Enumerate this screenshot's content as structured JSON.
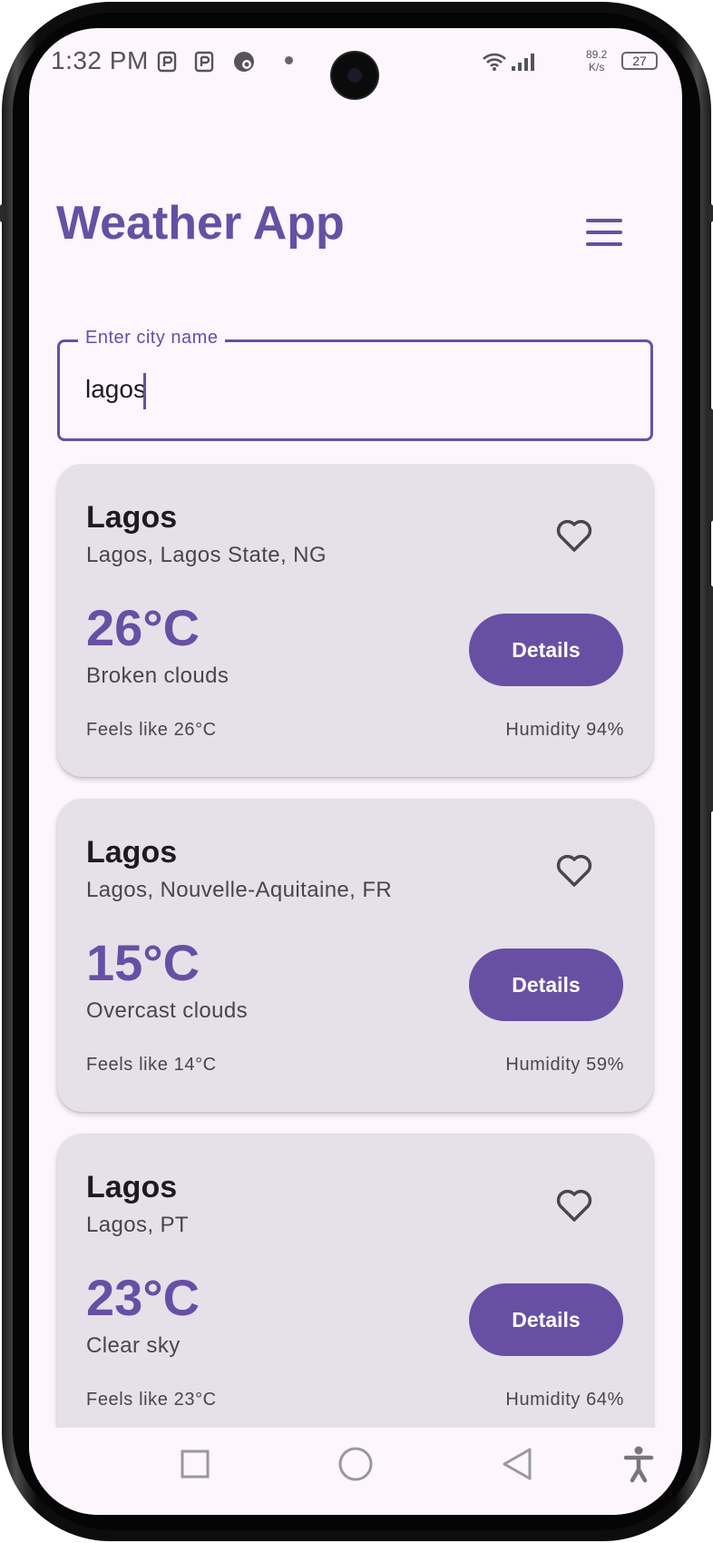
{
  "status_bar": {
    "time": "1:32 PM",
    "net_speed_value": "89.2",
    "net_speed_unit": "K/s",
    "battery": "27",
    "icons": [
      "notification-p-icon",
      "notification-p-icon",
      "notification-app-icon",
      "wifi-icon",
      "signal-icon",
      "battery-icon"
    ]
  },
  "header": {
    "title": "Weather App",
    "menu_icon": "hamburger-menu-icon"
  },
  "search": {
    "label": "Enter city name",
    "value": "lagos"
  },
  "results": [
    {
      "city": "Lagos",
      "region": "Lagos, Lagos State, NG",
      "temperature": "26°C",
      "condition": "Broken clouds",
      "feels_like": "Feels like 26°C",
      "humidity": "Humidity 94%",
      "details_label": "Details"
    },
    {
      "city": "Lagos",
      "region": "Lagos, Nouvelle-Aquitaine, FR",
      "temperature": "15°C",
      "condition": "Overcast clouds",
      "feels_like": "Feels like 14°C",
      "humidity": "Humidity 59%",
      "details_label": "Details"
    },
    {
      "city": "Lagos",
      "region": "Lagos, PT",
      "temperature": "23°C",
      "condition": "Clear sky",
      "feels_like": "Feels like 23°C",
      "humidity": "Humidity 64%",
      "details_label": "Details"
    }
  ],
  "nav_bar": {
    "icons": [
      "recents-square-icon",
      "home-circle-icon",
      "back-triangle-icon",
      "accessibility-icon"
    ]
  },
  "colors": {
    "primary": "#6750a4",
    "background": "#fdf6fc",
    "card": "#e6e0e9",
    "text": "#1d1b20",
    "text_secondary": "#49454f"
  }
}
